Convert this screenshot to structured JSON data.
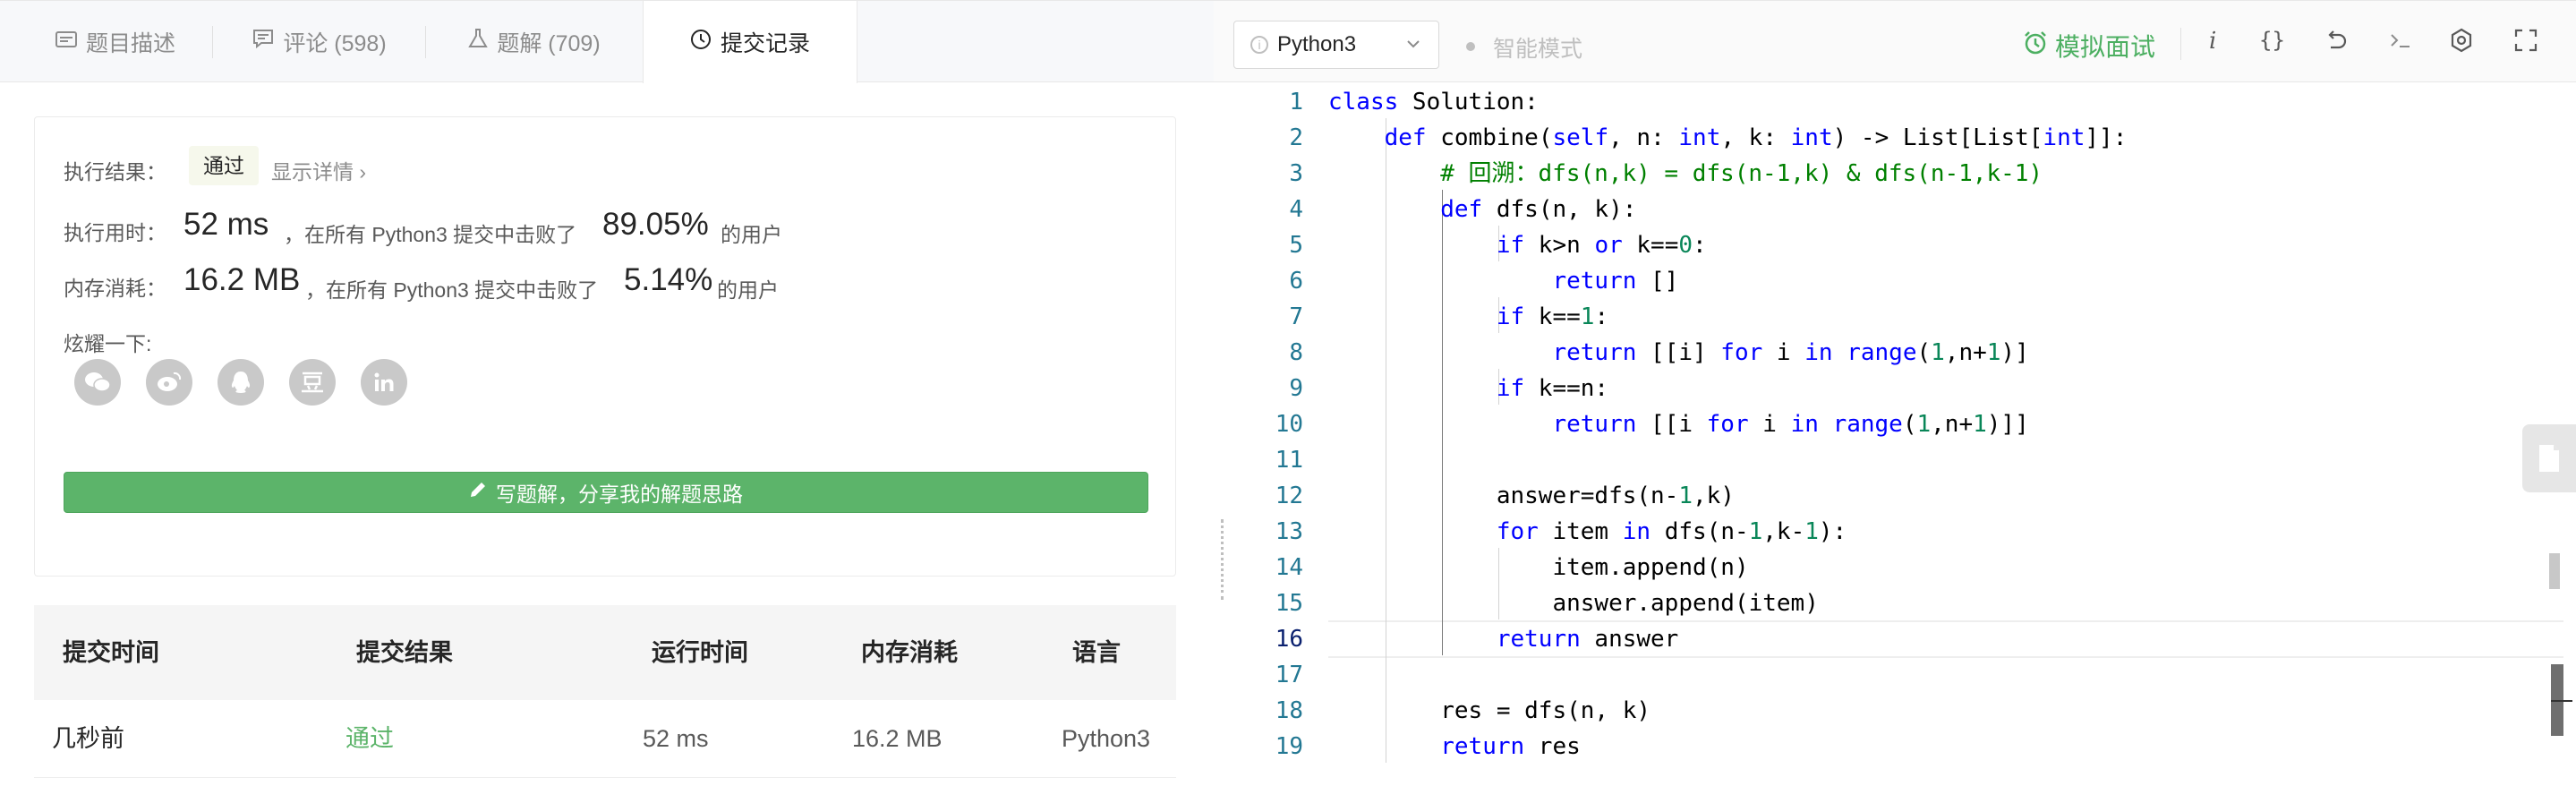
{
  "tabs": [
    {
      "label": "题目描述",
      "icon": "description-icon"
    },
    {
      "label": "评论 (598)",
      "icon": "comment-icon"
    },
    {
      "label": "题解 (709)",
      "icon": "flask-icon"
    },
    {
      "label": "提交记录",
      "icon": "clock-icon"
    }
  ],
  "result": {
    "status_label": "执行结果：",
    "status": "通过",
    "detail_link": "显示详情 ›",
    "runtime_label": "执行用时：",
    "runtime": "52 ms",
    "runtime_text": "，在所有 Python3 提交中击败了",
    "runtime_pct": "89.05%",
    "runtime_suffix": "的用户",
    "memory_label": "内存消耗：",
    "memory": "16.2 MB",
    "memory_text": "，在所有 Python3 提交中击败了",
    "memory_pct": "5.14%",
    "memory_suffix": "的用户",
    "share_label": "炫耀一下:",
    "share_icons": [
      "wechat-icon",
      "weibo-icon",
      "qq-icon",
      "douban-icon",
      "linkedin-icon"
    ],
    "write_button": "写题解，分享我的解题思路"
  },
  "table": {
    "headers": [
      "提交时间",
      "提交结果",
      "运行时间",
      "内存消耗",
      "语言"
    ],
    "rows": [
      [
        "几秒前",
        "通过",
        "52 ms",
        "16.2 MB",
        "Python3"
      ]
    ]
  },
  "toolbar": {
    "language": "Python3",
    "smart_mode": "智能模式",
    "mock_interview": "模拟面试",
    "icons": [
      "info-icon",
      "braces-icon",
      "undo-icon",
      "console-icon",
      "settings-icon",
      "fullscreen-icon"
    ]
  },
  "editor": {
    "current_line": 16,
    "lines": [
      "class Solution:",
      "    def combine(self, n: int, k: int) -> List[List[int]]:",
      "        # 回溯：dfs(n,k) = dfs(n-1,k) & dfs(n-1,k-1)",
      "        def dfs(n, k):",
      "            if k>n or k==0:",
      "                return []",
      "            if k==1:",
      "                return [[i] for i in range(1,n+1)]",
      "            if k==n:",
      "                return [[i for i in range(1,n+1)]]",
      "",
      "            answer=dfs(n-1,k)",
      "            for item in dfs(n-1,k-1):",
      "                item.append(n)",
      "                answer.append(item)",
      "            return answer",
      "",
      "        res = dfs(n, k)",
      "        return res"
    ]
  },
  "colors": {
    "accent_green": "#5cb46a",
    "pass_green": "#4caf61",
    "keyword_blue": "#0000ff",
    "comment_green": "#008000",
    "number_teal": "#098658",
    "line_number": "#237893"
  }
}
